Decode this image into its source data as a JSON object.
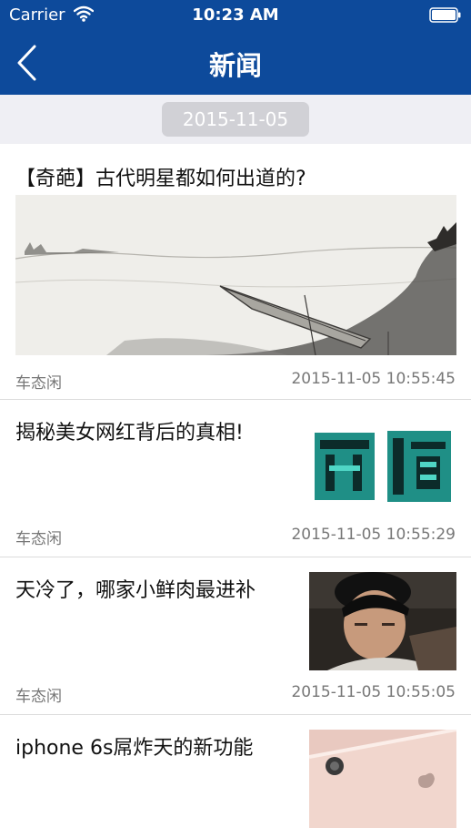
{
  "status_bar": {
    "carrier": "Carrier",
    "time": "10:23 AM"
  },
  "nav": {
    "title": "新闻",
    "back_icon": "chevron-left-icon"
  },
  "date_header": "2015-11-05",
  "articles": [
    {
      "title": "【奇葩】古代明星都如何出道的?",
      "source": "车态闲",
      "time": "2015-11-05 10:55:45",
      "image": "ink-painting-boat"
    },
    {
      "title": "揭秘美女网红背后的真相!",
      "source": "车态闲",
      "time": "2015-11-05 10:55:29",
      "image": "zhenxiang-calligraphy"
    },
    {
      "title": "天冷了，哪家小鲜肉最进补",
      "source": "车态闲",
      "time": "2015-11-05 10:55:05",
      "image": "young-man-portrait"
    },
    {
      "title": "iphone 6s屌炸天的新功能",
      "image": "rose-gold-iphone"
    }
  ],
  "colors": {
    "nav_bg": "#0d4a9b",
    "band_bg": "#efeff4",
    "pill_bg": "#d1d1d6",
    "meta_text": "#777777"
  }
}
